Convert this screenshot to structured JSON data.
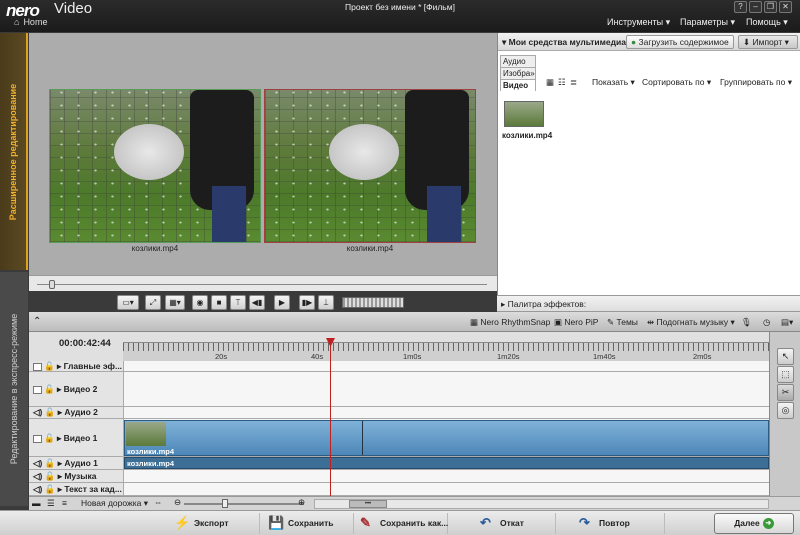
{
  "title_bar": {
    "logo": "nero",
    "app_name": "Video",
    "home_label": "Home",
    "document_title": "Проект без имени * [Фильм]",
    "menus": [
      {
        "label": "Инструменты ▾"
      },
      {
        "label": "Параметры ▾"
      },
      {
        "label": "Помощь ▾"
      }
    ],
    "window_buttons": [
      "?",
      "–",
      "❐",
      "✕"
    ]
  },
  "left_tabs": {
    "advanced": "Расширенное редактирование",
    "express": "Редактирование в экспресс-режиме"
  },
  "preview": {
    "left_caption": "козлики.mp4",
    "right_caption": "козлики.mp4"
  },
  "media_panel": {
    "header_title": "Мои средства мультимедиа",
    "upload_button": "Загрузить содержимое",
    "import_button": "Импорт",
    "tabs": [
      "Аудио",
      "Изобра»",
      "Видео"
    ],
    "show_button": "Показать",
    "sort_button": "Сортировать по",
    "group_button": "Группировать по",
    "items": [
      {
        "label": "козлики.mp4"
      }
    ]
  },
  "effects_palette": {
    "label": "Палитра эффектов:"
  },
  "timeline_toolbar": {
    "rhythm_snap": "Nero RhythmSnap",
    "pip": "Nero PiP",
    "themes": "Темы",
    "fit_music": "Подогнать музыку"
  },
  "timeline": {
    "timecode": "00:00:42:44",
    "ruler_labels": [
      "20s",
      "40s",
      "1m0s",
      "1m20s",
      "1m40s",
      "2m0s"
    ],
    "tracks": [
      {
        "label": "Главные эф..."
      },
      {
        "label": "Видео 2"
      },
      {
        "label": "Аудио 2"
      },
      {
        "label": "Видео 1"
      },
      {
        "label": "Аудио 1"
      },
      {
        "label": "Музыка"
      },
      {
        "label": "Текст за кад..."
      }
    ],
    "video_clip_label": "козлики.mp4",
    "audio_clip_label": "козлики.mp4",
    "new_track": "Новая дорожка"
  },
  "footer": {
    "export": "Экспорт",
    "save": "Сохранить",
    "save_as": "Сохранить как...",
    "undo": "Откат",
    "redo": "Повтор",
    "next": "Далее"
  }
}
